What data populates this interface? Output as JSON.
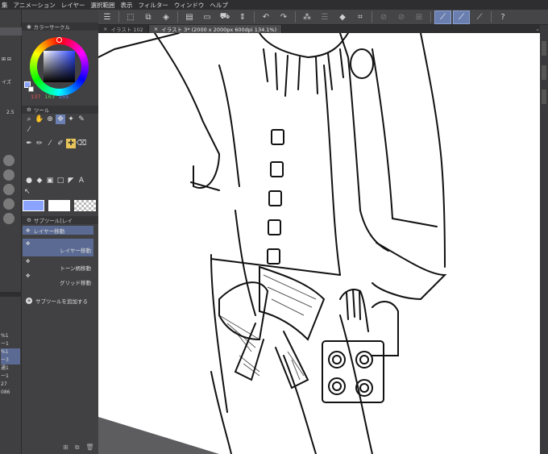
{
  "menu": [
    "集",
    "アニメーション",
    "レイヤー",
    "選択範囲",
    "表示",
    "フィルター",
    "ウィンドウ",
    "ヘルプ"
  ],
  "toolbar_icons": [
    "menu-icon",
    "transform-icon",
    "copy-icon",
    "fill-icon",
    "save-icon",
    "open-icon",
    "folder-icon",
    "up-down-icon",
    "undo-icon",
    "redo-icon",
    "selection-icon",
    "layer-icon",
    "fill-bucket-icon",
    "crop-icon",
    "snap-off-icon",
    "snap-off2-icon",
    "ruler-snap-icon",
    "grid-snap-icon",
    "perspective-snap-icon",
    "question-icon"
  ],
  "tabs": {
    "tab1": "イラスト 102",
    "tab2": "イラスト 3* (2000 x 2000px 600dpi 134.1%)"
  },
  "color_panel": {
    "title": "カラーサークル",
    "r": "137",
    "g": "163",
    "b": "255",
    "main_color": "#89a3ff"
  },
  "tool_panel": {
    "title": "ツール"
  },
  "subtool_panel": {
    "title": "サブツール[レイ",
    "header_item": "レイヤー移動",
    "items": [
      {
        "label": "",
        "right": "レイヤー移動"
      },
      {
        "label": "",
        "right": "トーン柄移動"
      },
      {
        "label": "",
        "right": "グリッド移動"
      }
    ],
    "add_label": "サブツールを追加する"
  },
  "left_labels": {
    "a": "イズ",
    "b": "2.5"
  },
  "layer_snippets": [
    "%1",
    "ー1",
    "%1",
    "ー3",
    "通1",
    "ー1",
    "27",
    "086"
  ]
}
